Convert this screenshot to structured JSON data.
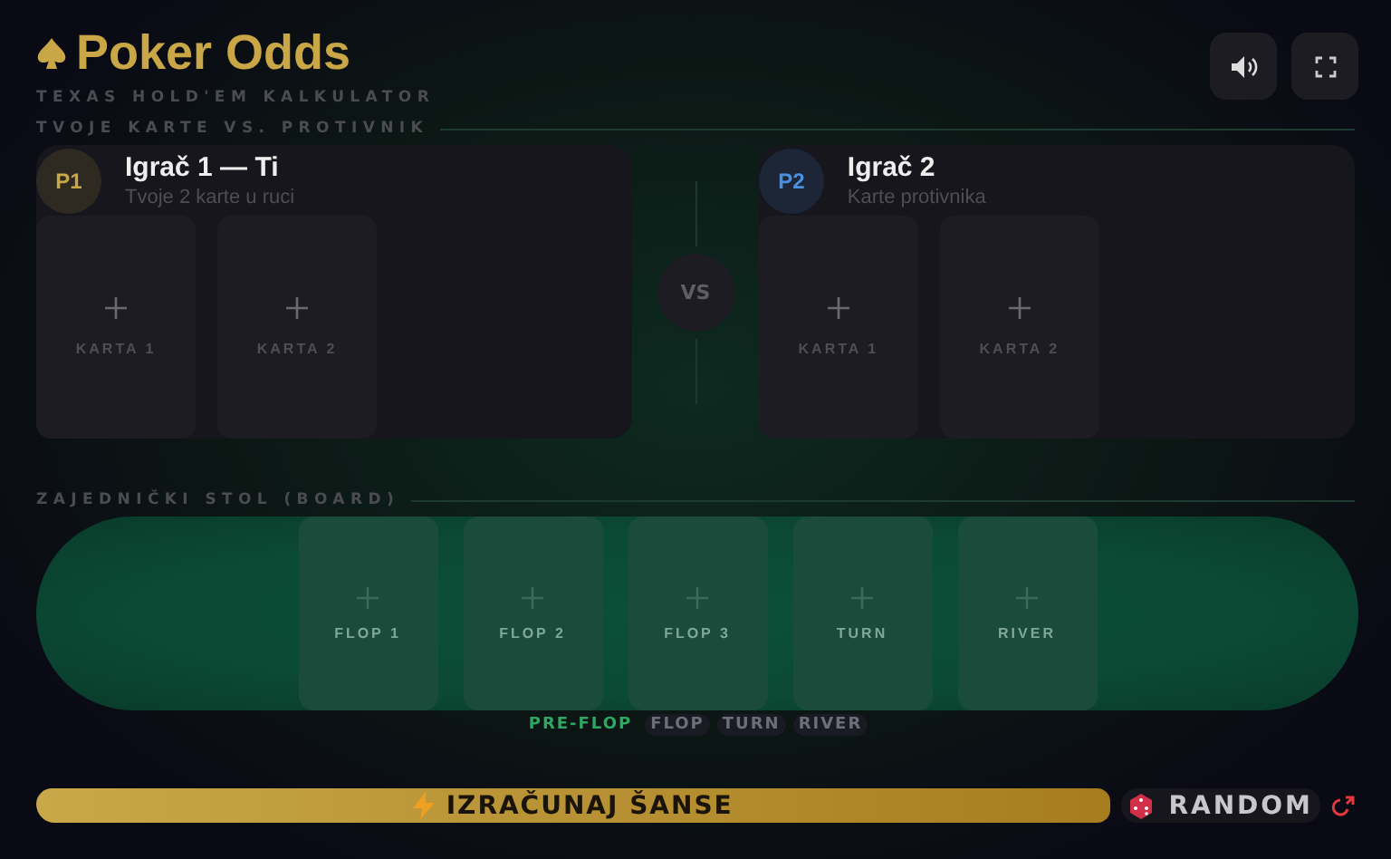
{
  "header": {
    "title": "Poker Odds",
    "subtitle": "TEXAS HOLD'EM KALKULATOR"
  },
  "players_section": {
    "label": "TVOJE KARTE VS. PROTIVNIK",
    "vs": "VS"
  },
  "players": [
    {
      "badge": "P1",
      "name": "Igrač 1 — Ti",
      "hint": "Tvoje 2 karte u ruci",
      "color": "#c9a646",
      "cards": [
        "KARTA 1",
        "KARTA 2"
      ]
    },
    {
      "badge": "P2",
      "name": "Igrač 2",
      "hint": "Karte protivnika",
      "color": "#4a8fe0",
      "cards": [
        "KARTA 1",
        "KARTA 2"
      ]
    }
  ],
  "board": {
    "label": "ZAJEDNIČKI STOL (BOARD)",
    "cards": [
      "FLOP 1",
      "FLOP 2",
      "FLOP 3",
      "TURN",
      "RIVER"
    ]
  },
  "stages": [
    {
      "label": "PRE-FLOP",
      "selected": true
    },
    {
      "label": "FLOP",
      "selected": false
    },
    {
      "label": "TURN",
      "selected": false
    },
    {
      "label": "RIVER",
      "selected": false
    }
  ],
  "actions": {
    "calculate": "IZRAČUNAJ ŠANSE",
    "random": "RANDOM"
  }
}
